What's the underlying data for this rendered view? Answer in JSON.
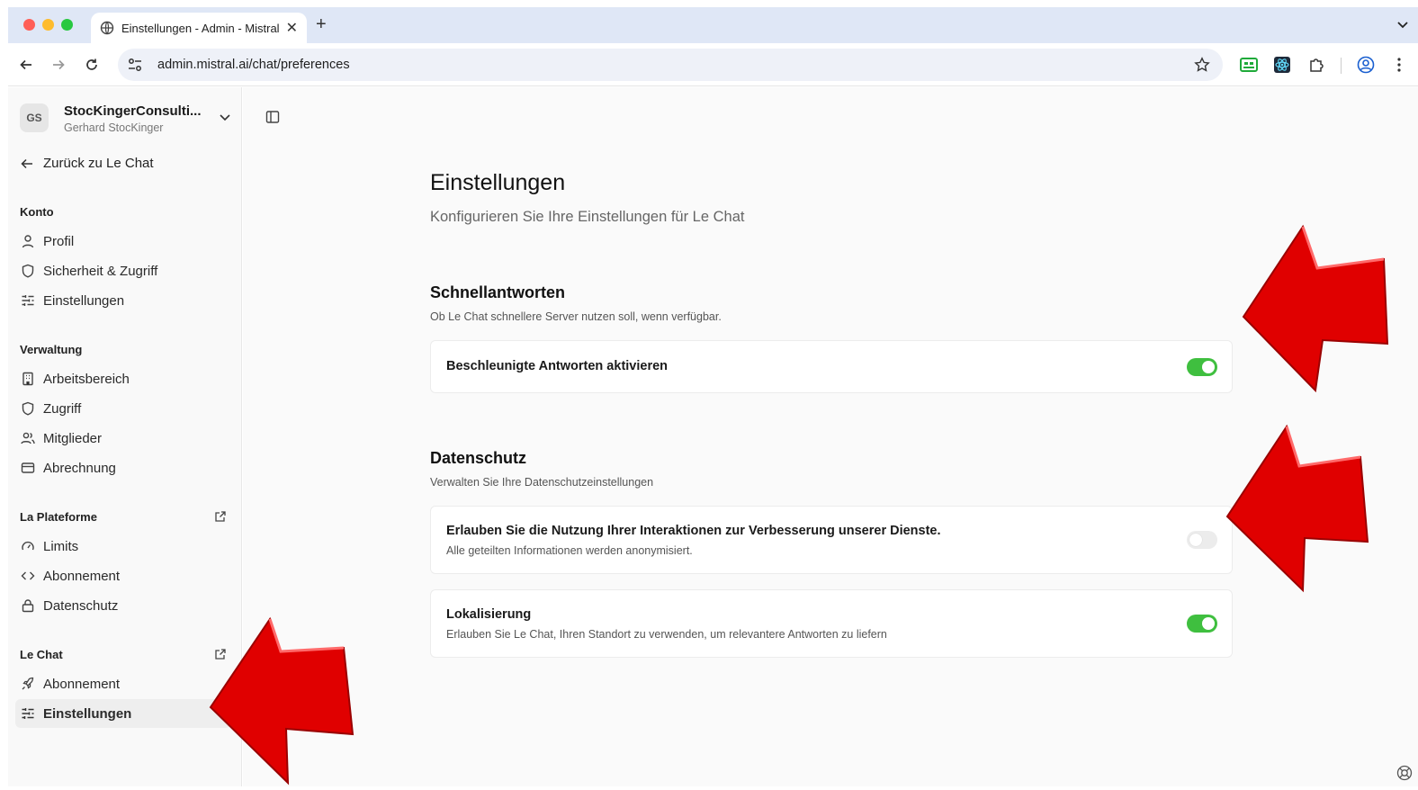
{
  "browser": {
    "tab_title": "Einstellungen - Admin - Mistral",
    "url": "admin.mistral.ai/chat/preferences"
  },
  "sidebar": {
    "org_initials": "GS",
    "org_name": "StocKingerConsulti...",
    "org_user": "Gerhard StocKinger",
    "back_label": "Zurück zu Le Chat",
    "konto": {
      "label": "Konto",
      "items": [
        "Profil",
        "Sicherheit & Zugriff",
        "Einstellungen"
      ]
    },
    "verwaltung": {
      "label": "Verwaltung",
      "items": [
        "Arbeitsbereich",
        "Zugriff",
        "Mitglieder",
        "Abrechnung"
      ]
    },
    "plateforme": {
      "label": "La Plateforme",
      "items": [
        "Limits",
        "Abonnement",
        "Datenschutz"
      ]
    },
    "lechat": {
      "label": "Le Chat",
      "items": [
        "Abonnement",
        "Einstellungen"
      ]
    }
  },
  "main": {
    "title": "Einstellungen",
    "subtitle": "Konfigurieren Sie Ihre Einstellungen für Le Chat",
    "schnell": {
      "title": "Schnellantworten",
      "description": "Ob Le Chat schnellere Server nutzen soll, wenn verfügbar.",
      "card_title": "Beschleunigte Antworten aktivieren",
      "enabled": true
    },
    "datenschutz": {
      "title": "Datenschutz",
      "description": "Verwalten Sie Ihre Datenschutzeinstellungen",
      "training_title": "Erlauben Sie die Nutzung Ihrer Interaktionen zur Verbesserung unserer Dienste.",
      "training_desc": "Alle geteilten Informationen werden anonymisiert.",
      "training_enabled": false,
      "loc_title": "Lokalisierung",
      "loc_desc": "Erlauben Sie Le Chat, Ihren Standort zu verwenden, um relevantere Antworten zu liefern",
      "loc_enabled": true
    }
  },
  "colors": {
    "toggle_on": "#3fbf3f",
    "annotation_arrow": "#e00000"
  }
}
